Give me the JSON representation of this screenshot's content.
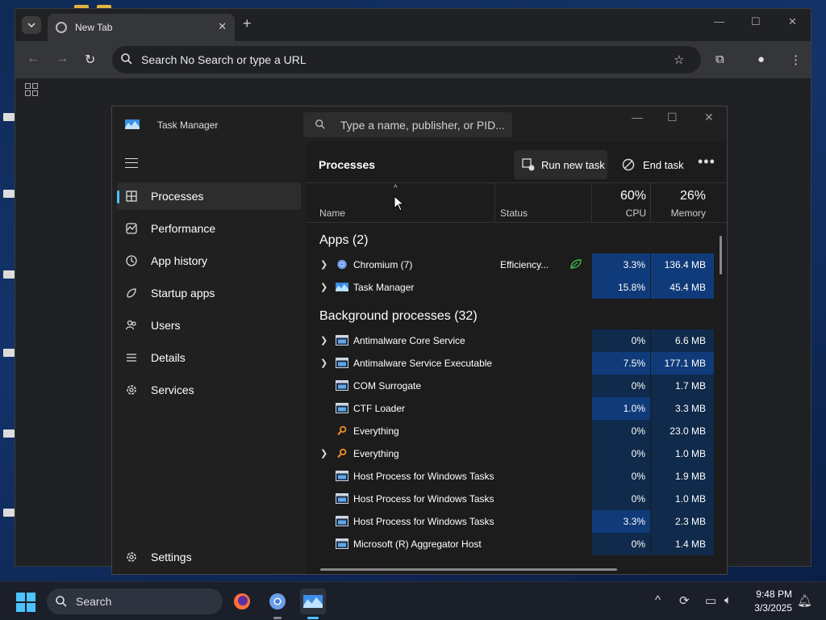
{
  "chrome": {
    "tab_title": "New Tab",
    "omnibox_placeholder": "Search No Search or type a URL"
  },
  "task_manager": {
    "title": "Task Manager",
    "search_placeholder": "Type a name, publisher, or PID...",
    "nav": [
      {
        "label": "Processes",
        "icon": "processes-icon"
      },
      {
        "label": "Performance",
        "icon": "performance-icon"
      },
      {
        "label": "App history",
        "icon": "app-history-icon"
      },
      {
        "label": "Startup apps",
        "icon": "startup-apps-icon"
      },
      {
        "label": "Users",
        "icon": "users-icon"
      },
      {
        "label": "Details",
        "icon": "details-icon"
      },
      {
        "label": "Services",
        "icon": "services-icon"
      }
    ],
    "settings_label": "Settings",
    "page_title": "Processes",
    "run_new_task_label": "Run new task",
    "end_task_label": "End task",
    "columns": {
      "name": "Name",
      "status": "Status",
      "cpu": "CPU",
      "memory": "Memory"
    },
    "cpu_total": "60%",
    "memory_total": "26%",
    "apps_header": "Apps (2)",
    "apps": [
      {
        "name": "Chromium (7)",
        "status": "Efficiency...",
        "cpu": "3.3%",
        "memory": "136.4 MB",
        "expandable": true,
        "icon": "chromium-icon",
        "eco": true
      },
      {
        "name": "Task Manager",
        "status": "",
        "cpu": "15.8%",
        "memory": "45.4 MB",
        "expandable": true,
        "icon": "task-manager-icon",
        "eco": false
      }
    ],
    "bg_header": "Background processes (32)",
    "background": [
      {
        "name": "Antimalware Core Service",
        "cpu": "0%",
        "memory": "6.6 MB",
        "expandable": true,
        "icon": "window-icon",
        "cpu_heat": 1,
        "mem_heat": 1
      },
      {
        "name": "Antimalware Service Executable",
        "cpu": "7.5%",
        "memory": "177.1 MB",
        "expandable": true,
        "icon": "window-icon",
        "cpu_heat": 2,
        "mem_heat": 2
      },
      {
        "name": "COM Surrogate",
        "cpu": "0%",
        "memory": "1.7 MB",
        "expandable": false,
        "icon": "window-icon",
        "cpu_heat": 1,
        "mem_heat": 1
      },
      {
        "name": "CTF Loader",
        "cpu": "1.0%",
        "memory": "3.3 MB",
        "expandable": false,
        "icon": "window-icon",
        "cpu_heat": 2,
        "mem_heat": 1
      },
      {
        "name": "Everything",
        "cpu": "0%",
        "memory": "23.0 MB",
        "expandable": false,
        "icon": "everything-icon",
        "cpu_heat": 1,
        "mem_heat": 1
      },
      {
        "name": "Everything",
        "cpu": "0%",
        "memory": "1.0 MB",
        "expandable": true,
        "icon": "everything-icon",
        "cpu_heat": 1,
        "mem_heat": 1
      },
      {
        "name": "Host Process for Windows Tasks",
        "cpu": "0%",
        "memory": "1.9 MB",
        "expandable": false,
        "icon": "window-icon",
        "cpu_heat": 1,
        "mem_heat": 1
      },
      {
        "name": "Host Process for Windows Tasks",
        "cpu": "0%",
        "memory": "1.0 MB",
        "expandable": false,
        "icon": "window-icon",
        "cpu_heat": 1,
        "mem_heat": 1
      },
      {
        "name": "Host Process for Windows Tasks",
        "cpu": "3.3%",
        "memory": "2.3 MB",
        "expandable": false,
        "icon": "window-icon",
        "cpu_heat": 2,
        "mem_heat": 1
      },
      {
        "name": "Microsoft (R) Aggregator Host",
        "cpu": "0%",
        "memory": "1.4 MB",
        "expandable": false,
        "icon": "window-icon",
        "cpu_heat": 1,
        "mem_heat": 1
      }
    ]
  },
  "taskbar": {
    "search_label": "Search",
    "time": "9:48 PM",
    "date": "3/3/2025"
  },
  "colors": {
    "accent": "#4cc2ff",
    "heat_low": "#0f2a4a",
    "heat_high": "#103b7a"
  }
}
